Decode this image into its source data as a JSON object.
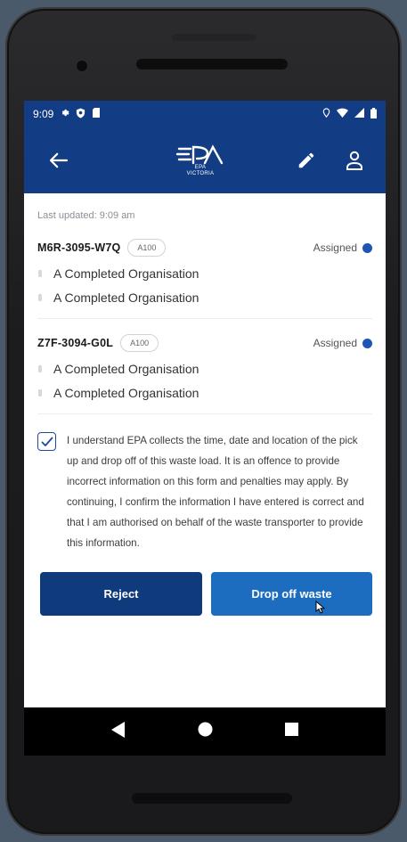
{
  "status_bar": {
    "time": "9:09",
    "left_icons": [
      "gear-icon",
      "shield-icon",
      "sd-card-icon"
    ],
    "right_icons": [
      "location-icon",
      "wifi-icon",
      "signal-icon",
      "battery-icon"
    ]
  },
  "header": {
    "logo_primary": "EPA",
    "logo_secondary": "VICTORIA",
    "back_icon": "back-arrow-icon",
    "edit_icon": "pencil-icon",
    "profile_icon": "user-icon"
  },
  "last_updated": "Last updated: 9:09 am",
  "records": [
    {
      "id": "M6R-3095-W7Q",
      "badge": "A100",
      "status": "Assigned",
      "from": "A Completed Organisation",
      "to": "A Completed Organisation"
    },
    {
      "id": "Z7F-3094-G0L",
      "badge": "A100",
      "status": "Assigned",
      "from": "A Completed Organisation",
      "to": "A Completed Organisation"
    }
  ],
  "consent": {
    "checked": true,
    "text": "I understand EPA collects the time, date and location of the pick up and drop off of this waste load. It is an offence to provide incorrect information on this form and penalties may apply. By continuing, I confirm the information I have entered is correct and that I am authorised on behalf of the waste transporter to provide this information."
  },
  "actions": {
    "reject_label": "Reject",
    "drop_off_label": "Drop off waste"
  },
  "colors": {
    "brand_blue": "#123c84",
    "status_dot": "#1d56b5",
    "reject_button": "#0f3a7c",
    "drop_off_button": "#1c6cc0"
  },
  "navbar": [
    "back-nav-icon",
    "home-nav-icon",
    "recents-nav-icon"
  ]
}
